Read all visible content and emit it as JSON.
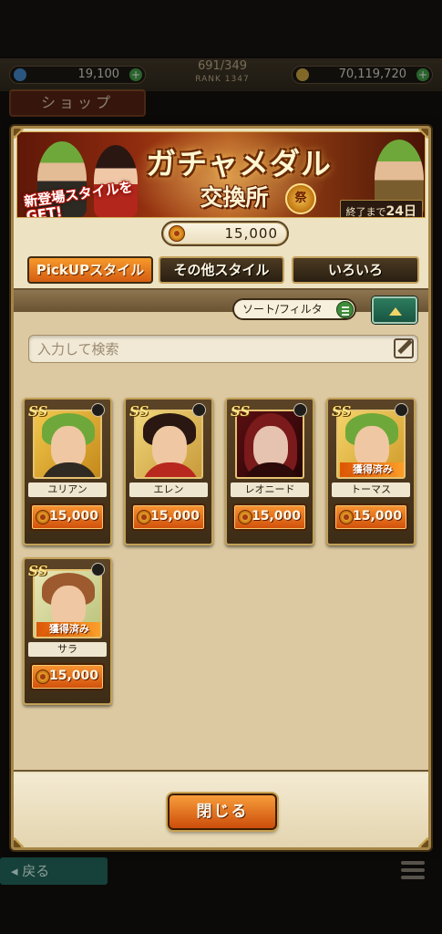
{
  "background": {
    "gems": "19,100",
    "bp": "691/349",
    "rank": "RANK 1347",
    "money": "70,119,720",
    "shop_label": "ショップ",
    "back_label": "◂ 戻る"
  },
  "banner": {
    "title": "ガチャメダル",
    "subtitle": "交換所",
    "medal_mark": "祭",
    "new_text": "新登場スタイルをGET!",
    "days_prefix": "終了まで",
    "days_value": "24日"
  },
  "medal_count": "15,000",
  "tabs": [
    {
      "label": "PickUPスタイル",
      "active": true
    },
    {
      "label": "その他スタイル",
      "active": false
    },
    {
      "label": "いろいろ",
      "active": false
    }
  ],
  "sort_label": "ソート/フィルタ",
  "search": {
    "placeholder": "入力して検索",
    "value": ""
  },
  "rank_mark": "SS",
  "items": [
    {
      "name": "ユリアン",
      "price": "15,000",
      "obtained": false
    },
    {
      "name": "エレン",
      "price": "15,000",
      "obtained": false
    },
    {
      "name": "レオニード",
      "price": "15,000",
      "obtained": false
    },
    {
      "name": "トーマス",
      "price": "15,000",
      "obtained": true
    },
    {
      "name": "サラ",
      "price": "15,000",
      "obtained": true
    }
  ],
  "obtained_label": "獲得済み",
  "close_label": "閉じる",
  "colors": {
    "accent_orange": "#e0711c",
    "frame_gold": "#c2a056",
    "panel": "#ede2c2",
    "toggle_green": "#2d7c5e"
  }
}
